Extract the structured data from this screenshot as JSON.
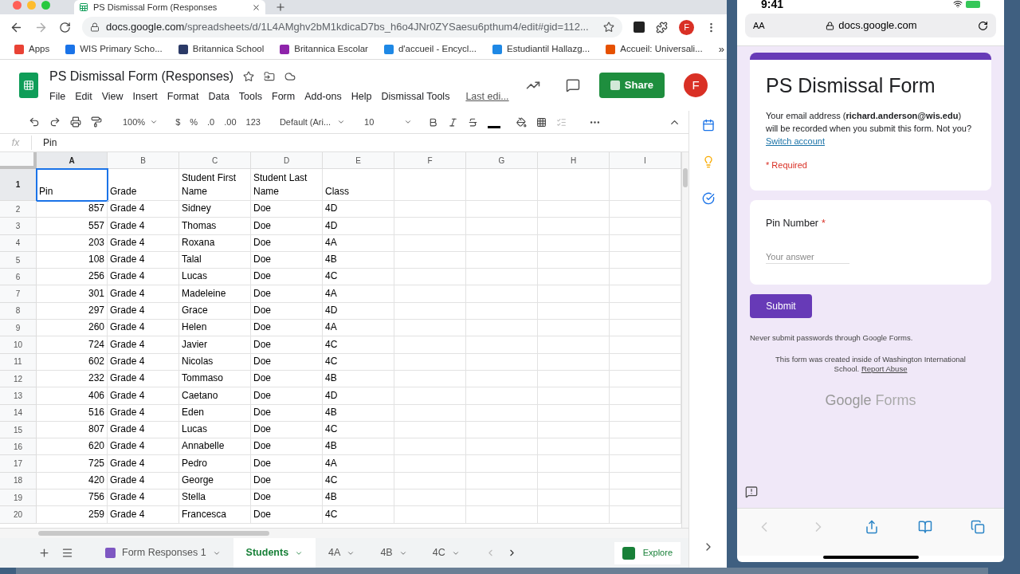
{
  "browser": {
    "tab_title": "PS Dismissal Form (Responses",
    "url_host": "docs.google.com",
    "url_path": "/spreadsheets/d/1L4AMghv2bM1kdicaD7bs_h6o4JNr0ZYSaesu6pthum4/edit#gid=112...",
    "profile": "F",
    "bookmarks": [
      {
        "label": "Apps",
        "color": "#e94235"
      },
      {
        "label": "WIS Primary Scho...",
        "color": "#1a73e8"
      },
      {
        "label": "Britannica School",
        "color": "#2b3a67"
      },
      {
        "label": "Britannica Escolar",
        "color": "#8e24aa"
      },
      {
        "label": "d'accueil - Encycl...",
        "color": "#1e88e5"
      },
      {
        "label": "Estudiantil Hallazg...",
        "color": "#1e88e5"
      },
      {
        "label": "Accueil: Universali...",
        "color": "#e65100"
      }
    ],
    "more_bookmarks": "»"
  },
  "sheets": {
    "title": "PS Dismissal Form (Responses)",
    "menus": [
      "File",
      "Edit",
      "View",
      "Insert",
      "Format",
      "Data",
      "Tools",
      "Form",
      "Add-ons",
      "Help",
      "Dismissal Tools"
    ],
    "last_edit": "Last edi...",
    "share": "Share",
    "avatar": "F",
    "toolbar": {
      "zoom": "100%",
      "currency": "$",
      "percent": "%",
      "decrease_decimal": ".0",
      "increase_decimal": ".00",
      "number_format": "123",
      "font": "Default (Ari...",
      "font_size": "10"
    },
    "formula_bar": {
      "fx": "fx",
      "value": "Pin"
    },
    "columns": [
      {
        "label": "A",
        "selected": true
      },
      {
        "label": "B",
        "selected": false
      },
      {
        "label": "C",
        "selected": false
      },
      {
        "label": "D",
        "selected": false
      },
      {
        "label": "E",
        "selected": false
      },
      {
        "label": "F",
        "selected": false
      },
      {
        "label": "G",
        "selected": false
      },
      {
        "label": "H",
        "selected": false
      },
      {
        "label": "I",
        "selected": false
      }
    ],
    "rows": [
      {
        "number": "1",
        "selected": true,
        "cells": [
          "Pin",
          "Grade",
          "Student First Name",
          "Student Last Name",
          "Class"
        ]
      },
      {
        "number": "2",
        "selected": false,
        "cells": [
          "857",
          "Grade 4",
          "Sidney",
          "Doe",
          "4D"
        ]
      },
      {
        "number": "3",
        "selected": false,
        "cells": [
          "557",
          "Grade 4",
          "Thomas",
          "Doe",
          "4D"
        ]
      },
      {
        "number": "4",
        "selected": false,
        "cells": [
          "203",
          "Grade 4",
          "Roxana",
          "Doe",
          "4A"
        ]
      },
      {
        "number": "5",
        "selected": false,
        "cells": [
          "108",
          "Grade 4",
          "Talal",
          "Doe",
          "4B"
        ]
      },
      {
        "number": "6",
        "selected": false,
        "cells": [
          "256",
          "Grade 4",
          "Lucas",
          "Doe",
          "4C"
        ]
      },
      {
        "number": "7",
        "selected": false,
        "cells": [
          "301",
          "Grade 4",
          "Madeleine",
          "Doe",
          "4A"
        ]
      },
      {
        "number": "8",
        "selected": false,
        "cells": [
          "297",
          "Grade 4",
          "Grace",
          "Doe",
          "4D"
        ]
      },
      {
        "number": "9",
        "selected": false,
        "cells": [
          "260",
          "Grade 4",
          "Helen",
          "Doe",
          "4A"
        ]
      },
      {
        "number": "10",
        "selected": false,
        "cells": [
          "724",
          "Grade 4",
          "Javier",
          "Doe",
          "4C"
        ]
      },
      {
        "number": "11",
        "selected": false,
        "cells": [
          "602",
          "Grade 4",
          "Nicolas",
          "Doe",
          "4C"
        ]
      },
      {
        "number": "12",
        "selected": false,
        "cells": [
          "232",
          "Grade 4",
          "Tommaso",
          "Doe",
          "4B"
        ]
      },
      {
        "number": "13",
        "selected": false,
        "cells": [
          "406",
          "Grade 4",
          "Caetano",
          "Doe",
          "4D"
        ]
      },
      {
        "number": "14",
        "selected": false,
        "cells": [
          "516",
          "Grade 4",
          "Eden",
          "Doe",
          "4B"
        ]
      },
      {
        "number": "15",
        "selected": false,
        "cells": [
          "807",
          "Grade 4",
          "Lucas",
          "Doe",
          "4C"
        ]
      },
      {
        "number": "16",
        "selected": false,
        "cells": [
          "620",
          "Grade 4",
          "Annabelle",
          "Doe",
          "4B"
        ]
      },
      {
        "number": "17",
        "selected": false,
        "cells": [
          "725",
          "Grade 4",
          "Pedro",
          "Doe",
          "4A"
        ]
      },
      {
        "number": "18",
        "selected": false,
        "cells": [
          "420",
          "Grade 4",
          "George",
          "Doe",
          "4C"
        ]
      },
      {
        "number": "19",
        "selected": false,
        "cells": [
          "756",
          "Grade 4",
          "Stella",
          "Doe",
          "4B"
        ]
      },
      {
        "number": "20",
        "selected": false,
        "cells": [
          "259",
          "Grade 4",
          "Francesca",
          "Doe",
          "4C"
        ]
      }
    ],
    "sheet_tabs": [
      {
        "label": "Form Responses 1",
        "kind": "form",
        "selected": false
      },
      {
        "label": "Students",
        "kind": "sheet",
        "selected": true
      },
      {
        "label": "4A",
        "kind": "sheet",
        "selected": false
      },
      {
        "label": "4B",
        "kind": "sheet",
        "selected": false
      },
      {
        "label": "4C",
        "kind": "sheet",
        "selected": false
      }
    ],
    "explore": "Explore"
  },
  "phone": {
    "time": "9:41",
    "text_size": "AA",
    "host": "docs.google.com",
    "form": {
      "title": "PS Dismissal Form",
      "email_notice": "Your email address (**richard.anderson@wis.edu**) will be recorded when you submit this form. Not you?",
      "switch_account": "Switch account",
      "required": "* Required",
      "question": "Pin Number",
      "question_required": "*",
      "placeholder": "Your answer",
      "submit": "Submit",
      "password_note": "Never submit passwords through Google Forms.",
      "created_note": "This form was created inside of Washington International School.",
      "report_abuse": "Report Abuse",
      "logo_google": "Google",
      "logo_forms": "Forms"
    }
  }
}
